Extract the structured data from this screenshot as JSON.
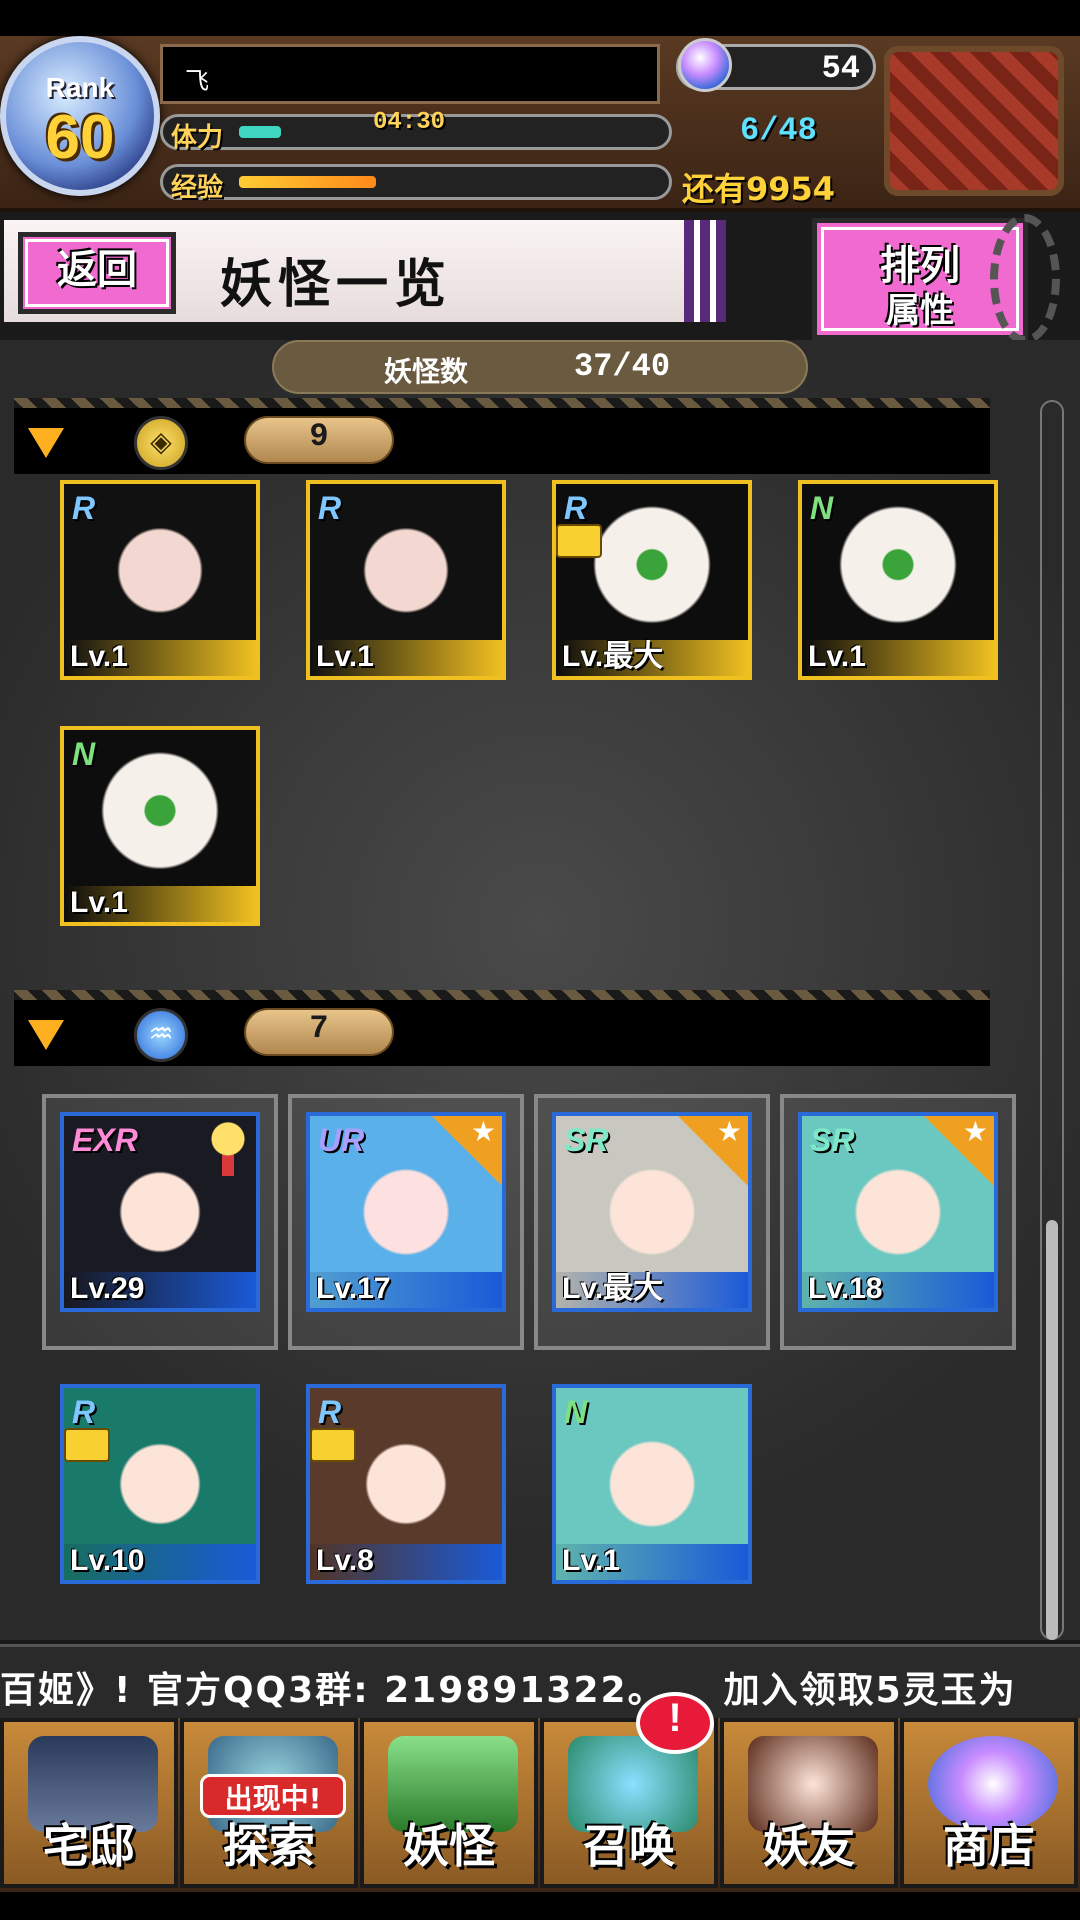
{
  "header": {
    "rank_label": "Rank",
    "rank_value": "60",
    "player_name": "飞",
    "stamina_label": "体力",
    "stamina_timer": "04:30",
    "stamina_fill": 0.1,
    "stamina_count": "6/48",
    "exp_label": "经验",
    "exp_fill": 0.33,
    "exp_remaining": "还有9954",
    "gem_count": "54"
  },
  "toolbar": {
    "back_label": "返回",
    "page_title": "妖怪一览",
    "sort_label": "排列",
    "sort_value": "属性"
  },
  "list": {
    "count_label": "妖怪数",
    "count_value": "37/40",
    "sections": [
      {
        "attribute_icon": "earth-attribute-icon",
        "count": "9",
        "cards": [
          {
            "rarity": "R",
            "level": "Lv.1"
          },
          {
            "rarity": "R",
            "level": "Lv.1"
          },
          {
            "rarity": "R",
            "level": "Lv.最大"
          },
          {
            "rarity": "N",
            "level": "Lv.1"
          },
          {
            "rarity": "N",
            "level": "Lv.1"
          }
        ]
      },
      {
        "attribute_icon": "water-attribute-icon",
        "count": "7",
        "cards": [
          {
            "rarity": "EXR",
            "level": "Lv.29"
          },
          {
            "rarity": "UR",
            "level": "Lv.17"
          },
          {
            "rarity": "SR",
            "level": "Lv.最大"
          },
          {
            "rarity": "SR",
            "level": "Lv.18"
          },
          {
            "rarity": "R",
            "level": "Lv.10"
          },
          {
            "rarity": "R",
            "level": "Lv.8"
          },
          {
            "rarity": "N",
            "level": "Lv.1"
          }
        ]
      }
    ]
  },
  "ticker": {
    "text": "百姬》! 官方QQ3群: 219891322。　　加入领取5灵玉为"
  },
  "nav": {
    "home": "宅邸",
    "explore": "探索",
    "explore_badge": "出现中!",
    "yokai": "妖怪",
    "summon": "召唤",
    "summon_alert": "!",
    "friends": "妖友",
    "shop": "商店"
  },
  "colors": {
    "accent_pink": "#f06ad0",
    "gold_frame": "#f0c020",
    "blue_frame": "#2a6ad8"
  }
}
